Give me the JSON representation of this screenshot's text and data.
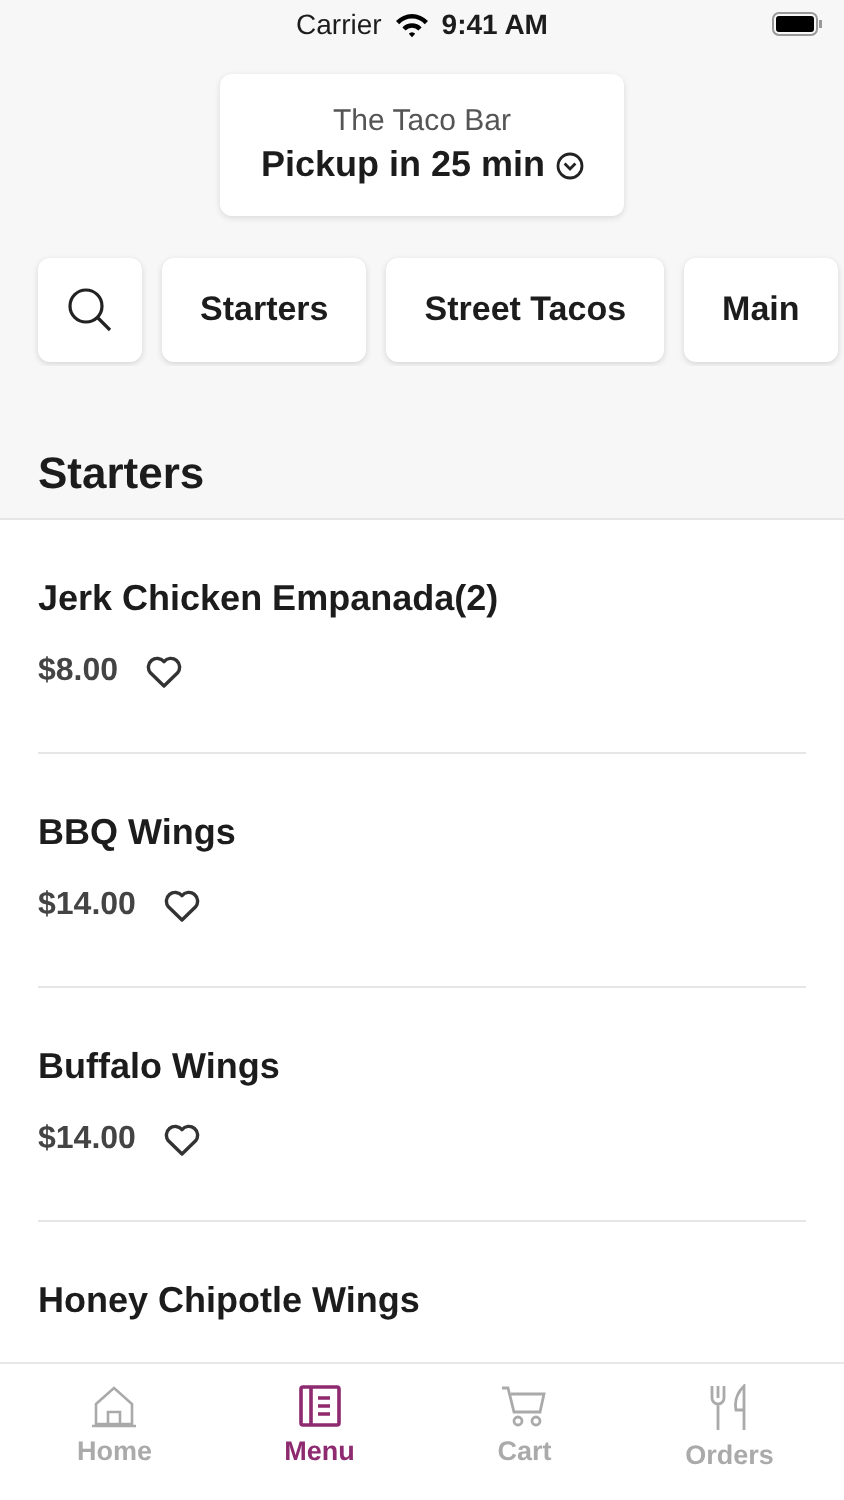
{
  "status_bar": {
    "carrier": "Carrier",
    "time": "9:41 AM"
  },
  "header": {
    "restaurant": "The Taco Bar",
    "pickup": "Pickup in 25 min"
  },
  "categories": [
    {
      "label": "Starters"
    },
    {
      "label": "Street Tacos"
    },
    {
      "label": "Main"
    }
  ],
  "section_title": "Starters",
  "items": [
    {
      "name": "Jerk Chicken Empanada(2)",
      "price": "$8.00"
    },
    {
      "name": "BBQ Wings",
      "price": "$14.00"
    },
    {
      "name": "Buffalo Wings",
      "price": "$14.00"
    },
    {
      "name": "Honey Chipotle Wings"
    }
  ],
  "tabs": [
    {
      "label": "Home",
      "kind": "home",
      "selected": false
    },
    {
      "label": "Menu",
      "kind": "menu",
      "selected": true
    },
    {
      "label": "Cart",
      "kind": "cart",
      "selected": false
    },
    {
      "label": "Orders",
      "kind": "orders",
      "selected": false
    }
  ]
}
